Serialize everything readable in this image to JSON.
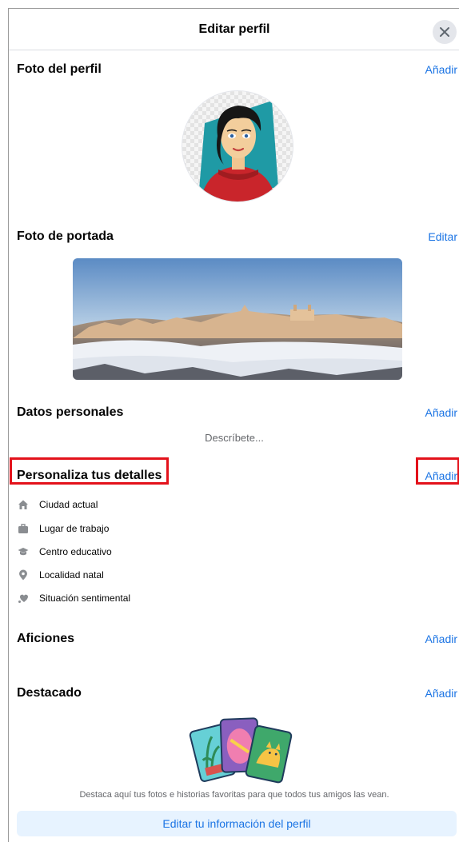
{
  "header": {
    "title": "Editar perfil"
  },
  "profile_photo": {
    "title": "Foto del perfil",
    "action": "Añadir"
  },
  "cover_photo": {
    "title": "Foto de portada",
    "action": "Editar"
  },
  "bio": {
    "title": "Datos personales",
    "action": "Añadir",
    "placeholder": "Descríbete..."
  },
  "details": {
    "title": "Personaliza tus detalles",
    "action": "Añadir",
    "items": [
      {
        "label": "Ciudad actual",
        "icon": "house-icon"
      },
      {
        "label": "Lugar de trabajo",
        "icon": "briefcase-icon"
      },
      {
        "label": "Centro educativo",
        "icon": "graduation-cap-icon"
      },
      {
        "label": "Localidad natal",
        "icon": "location-pin-icon"
      },
      {
        "label": "Situación sentimental",
        "icon": "heart-icon"
      }
    ]
  },
  "hobbies": {
    "title": "Aficiones",
    "action": "Añadir"
  },
  "featured": {
    "title": "Destacado",
    "action": "Añadir",
    "description": "Destaca aquí tus fotos e historias favoritas para que todos tus amigos las vean."
  },
  "footer": {
    "edit_button": "Editar tu información del perfil"
  },
  "colors": {
    "link": "#1b74e4",
    "highlight": "#e3121b",
    "button_bg": "#e7f3ff"
  }
}
